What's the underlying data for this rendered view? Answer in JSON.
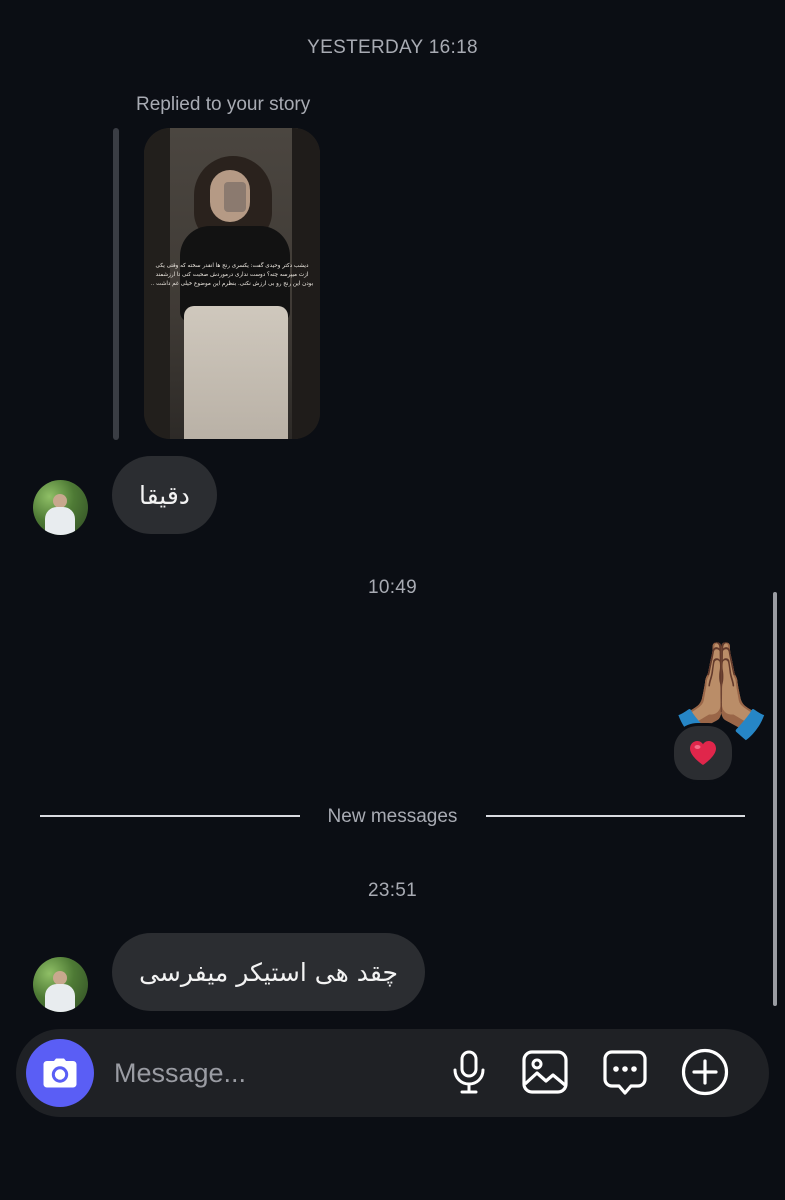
{
  "conversation": {
    "timestamp_1": "YESTERDAY 16:18",
    "story_reply_label": "Replied to your story",
    "story_caption": "دیشب دکتر وحیدی گفت: یکسری رنج ها انقدر سخته که وقتی یکی ازت میپرسه چته؟ دوست نداری درموردش صحبت کنی تا ارزشمند بودن این رنج رو بی ارزش نکنی. بنظرم این موضوع خیلی غم داشت ..",
    "message_1": "دقیقا",
    "timestamp_2": "10:49",
    "sent_emoji": "🙏🏽",
    "reaction_emoji": "❤️",
    "new_messages_label": "New messages",
    "timestamp_3": "23:51",
    "message_2": "چقد هی استیکر میفرسی"
  },
  "composer": {
    "placeholder": "Message..."
  },
  "colors": {
    "background": "#0b0e14",
    "bubble": "#2b2d31",
    "composer": "#1f2125",
    "camera_button": "#5a5ef5",
    "reaction_heart": "#e0264b"
  },
  "icons": {
    "camera": "camera-icon",
    "microphone": "microphone-icon",
    "gallery": "gallery-icon",
    "sticker": "sticker-icon",
    "plus": "plus-icon"
  }
}
